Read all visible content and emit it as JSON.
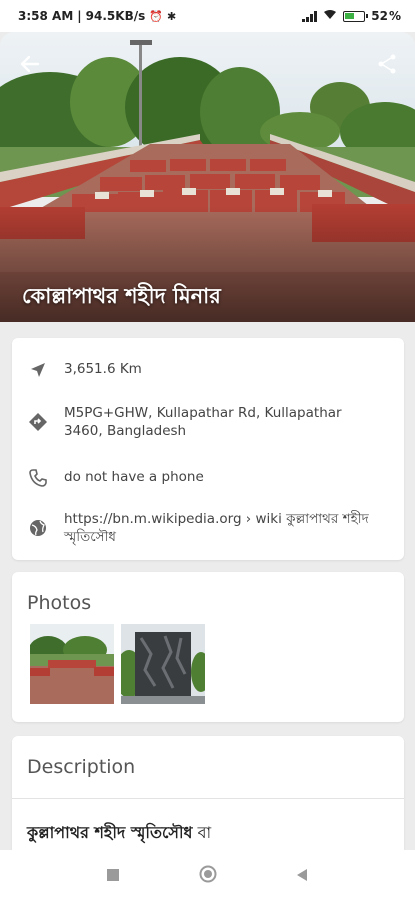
{
  "status_bar": {
    "time": "3:58 AM",
    "speed": "94.5KB/s",
    "battery": "52"
  },
  "hero": {
    "title": "কোল্লাপাথর শহীদ মিনার",
    "back_icon": "arrow-left-icon",
    "share_icon": "share-icon"
  },
  "info": {
    "distance": "3,651.6 Km",
    "address": "M5PG+GHW, Kullapathar Rd, Kullapathar 3460, Bangladesh",
    "phone": "do not have a phone",
    "website": "https://bn.m.wikipedia.org › wiki কুল্লাপাথর শহীদ স্মৃতিসৌধ"
  },
  "photos": {
    "heading": "Photos"
  },
  "description": {
    "heading": "Description",
    "text_bold": "কুল্লাপাথর শহীদ স্মৃতিসৌধ",
    "text_rest": " বা"
  },
  "colors": {
    "accent": "#3cb043",
    "card_bg": "#ffffff",
    "page_bg": "#ececec"
  }
}
